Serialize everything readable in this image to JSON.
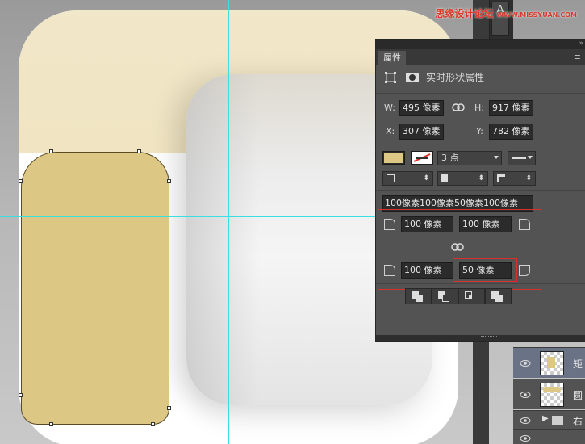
{
  "watermark": {
    "text": "思缘设计论坛",
    "url": "WWW.MISSYUAN.COM"
  },
  "toolbar": {
    "type_tool_glyph": "A"
  },
  "panel": {
    "tab_label": "属性",
    "header_title": "实时形状属性",
    "width_label": "W:",
    "width_value": "495 像素",
    "height_label": "H:",
    "height_value": "917 像素",
    "x_label": "X:",
    "x_value": "307 像素",
    "y_label": "Y:",
    "y_value": "782 像素",
    "fill_color": "#dcc784",
    "stroke_width": "3 点",
    "corner_summary": "100像素100像素50像素100像素",
    "corner_tl": "100 像素",
    "corner_tr": "100 像素",
    "corner_bl": "100 像素",
    "corner_br": "50 像素"
  },
  "layers": [
    {
      "name": "矩",
      "selected": true
    },
    {
      "name": "圆",
      "selected": false
    },
    {
      "name": "右",
      "selected": false,
      "is_group": true
    }
  ],
  "colors": {
    "highlight": "#d9302b",
    "guide": "#38e0e0",
    "selected_layer": "#6a7286"
  }
}
